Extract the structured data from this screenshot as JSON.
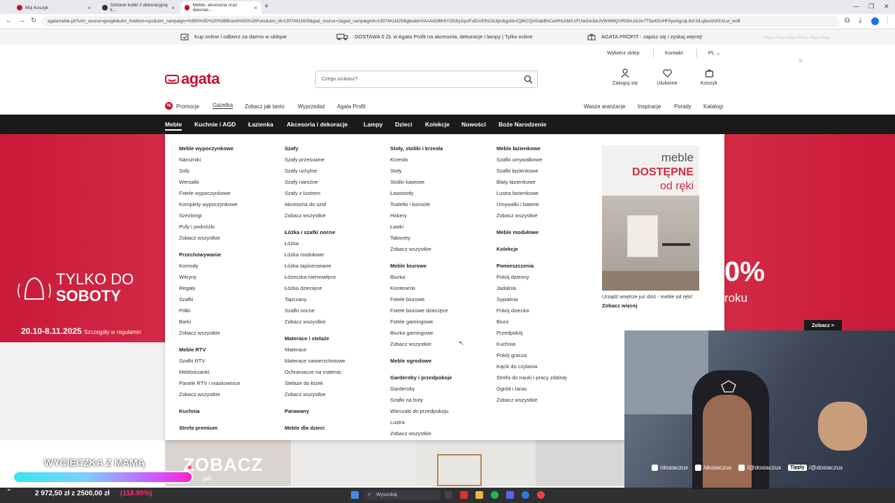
{
  "browser": {
    "tabs": [
      {
        "label": "Mój Koszyk"
      },
      {
        "label": "Szklane kubki z dekoracyjną k..."
      },
      {
        "label": "Meble, akcesoria oraz dekorac..."
      }
    ],
    "url": "agatameble.pl/?utm_source=google&utm_medium=cpc&utm_campaign=%5BS%5D%20%5BBrand%5D%20Pure&utm_id=13074411829&gad_source=1&gad_campaignid=13074411829&gbraid=0AAAADBK6YIZhKy1rpoFutDAEfhCbUIpc&gclid=Cj0KCQiA5abBhCaARIsAM3-zFUlaSre3drJVW4IMQVIR3ImJoUiv7TSp4OUHF8ywAgcqL9uf-5iLq8aAiAKEALw_wcB"
  },
  "infobar": {
    "item1": "Kup online i odbierz za darmo w sklepie",
    "item2": "DOSTAWA 0 ZŁ w Agata Profit na akcesoria, dekoracje i lampy | Tylko online",
    "item3": "AGATA PROFIT - zapisz się i zyskaj więcej!"
  },
  "utilbar": {
    "store": "Wybierz sklep",
    "contact": "Kontakt",
    "lang": "PL"
  },
  "header": {
    "logo": "agata",
    "search_placeholder": "Czego szukasz?",
    "login": "Zaloguj się",
    "favorites": "Ulubione",
    "cart": "Koszyk"
  },
  "subnav": {
    "left": [
      "Promocje",
      "Gazetka",
      "Zobacz jak tanio",
      "Wyprzedaż",
      "Agata Profit"
    ],
    "right": [
      "Wasze aranżacje",
      "Inspiracje",
      "Porady",
      "Katalogi"
    ]
  },
  "mainnav": [
    "Meble",
    "Kuchnie i AGD",
    "Łazienka",
    "Akcesoria i dekoracje",
    "Lampy",
    "Dzieci",
    "Kolekcje",
    "Nowości",
    "Boże Narodzenie"
  ],
  "mega": {
    "col1": [
      {
        "t": "Meble wypoczynkowe",
        "h": true
      },
      {
        "t": "Narożniki"
      },
      {
        "t": "Sofy"
      },
      {
        "t": "Wersalki"
      },
      {
        "t": "Fotele wypoczynkowe"
      },
      {
        "t": "Komplety wypoczynkowe"
      },
      {
        "t": "Szezlongi"
      },
      {
        "t": "Pufy i podnóżki"
      },
      {
        "t": "Zobacz wszystkie"
      },
      {
        "t": "Przechowywanie",
        "h": true
      },
      {
        "t": "Komody"
      },
      {
        "t": "Witryny"
      },
      {
        "t": "Regały"
      },
      {
        "t": "Szafki"
      },
      {
        "t": "Półki"
      },
      {
        "t": "Barki"
      },
      {
        "t": "Zobacz wszystkie"
      },
      {
        "t": "Meble RTV",
        "h": true
      },
      {
        "t": "Szafki RTV"
      },
      {
        "t": "Meblościanki"
      },
      {
        "t": "Panele RTV i maskownice"
      },
      {
        "t": "Zobacz wszystkie"
      },
      {
        "t": "Kuchnia",
        "h": true
      },
      {
        "t": "Strefa premium",
        "h": true
      }
    ],
    "col2": [
      {
        "t": "Szafy",
        "h": true
      },
      {
        "t": "Szafy przesuwne"
      },
      {
        "t": "Szafy uchylne"
      },
      {
        "t": "Szafy narożne"
      },
      {
        "t": "Szafy z lustrem"
      },
      {
        "t": "Akcesoria do szaf"
      },
      {
        "t": "Zobacz wszystkie"
      },
      {
        "t": "Łóżka i szafki nocne",
        "h": true
      },
      {
        "t": "Łóżka"
      },
      {
        "t": "Łóżka modułowe"
      },
      {
        "t": "Łóżka tapicerowane"
      },
      {
        "t": "Łóżeczka niemowlęce"
      },
      {
        "t": "Łóżka dziecięce"
      },
      {
        "t": "Tapczany"
      },
      {
        "t": "Szafki nocne"
      },
      {
        "t": "Zobacz wszystkie"
      },
      {
        "t": "Materace i stelaże",
        "h": true
      },
      {
        "t": "Materace"
      },
      {
        "t": "Materace nawierzchniowe"
      },
      {
        "t": "Ochraniacze na materac"
      },
      {
        "t": "Stelaże do łóżek"
      },
      {
        "t": "Zobacz wszystkie"
      },
      {
        "t": "Parawany",
        "h": true
      },
      {
        "t": "Meble dla dzieci",
        "h": true
      }
    ],
    "col3": [
      {
        "t": "Stoły, stoliki i krzesła",
        "h": true
      },
      {
        "t": "Krzesła"
      },
      {
        "t": "Stoły"
      },
      {
        "t": "Stoliki kawowe"
      },
      {
        "t": "Ławostoły"
      },
      {
        "t": "Toaletki i konsole"
      },
      {
        "t": "Hokery"
      },
      {
        "t": "Ławki"
      },
      {
        "t": "Taborety"
      },
      {
        "t": "Zobacz wszystkie"
      },
      {
        "t": "Meble biurowe",
        "h": true
      },
      {
        "t": "Biurka"
      },
      {
        "t": "Kontenerki"
      },
      {
        "t": "Fotele biurowe"
      },
      {
        "t": "Fotele biurowe dziecięce"
      },
      {
        "t": "Fotele gamingowe"
      },
      {
        "t": "Biurka gamingowe"
      },
      {
        "t": "Zobacz wszystkie"
      },
      {
        "t": "Meble ogrodowe",
        "h": true
      },
      {
        "t": "Garderoby i przedpokoje",
        "h": true
      },
      {
        "t": "Garderoby"
      },
      {
        "t": "Szafki na buty"
      },
      {
        "t": "Wieszaki do przedpokoju"
      },
      {
        "t": "Lustra"
      },
      {
        "t": "Zobacz wszystkie"
      }
    ],
    "col4": [
      {
        "t": "Meble łazienkowe",
        "h": true
      },
      {
        "t": "Szafki umywalkowe"
      },
      {
        "t": "Szafki łazienkowe"
      },
      {
        "t": "Blaty łazienkowe"
      },
      {
        "t": "Lustra łazienkowe"
      },
      {
        "t": "Umywalki i baterie"
      },
      {
        "t": "Zobacz wszystkie"
      },
      {
        "t": "Meble modułowe",
        "h": true
      },
      {
        "t": "Kolekcje",
        "h": true
      },
      {
        "t": "Pomieszczenia",
        "h": true
      },
      {
        "t": "Pokój dzienny"
      },
      {
        "t": "Jadalnia"
      },
      {
        "t": "Sypialnia"
      },
      {
        "t": "Pokój dziecka"
      },
      {
        "t": "Biuro"
      },
      {
        "t": "Przedpokój"
      },
      {
        "t": "Kuchnia"
      },
      {
        "t": "Pokój gracza"
      },
      {
        "t": "Kącik do czytania"
      },
      {
        "t": "Strefa do nauki i pracy zdalnej"
      },
      {
        "t": "Ogród i taras"
      },
      {
        "t": "Zobacz wszystkie"
      }
    ],
    "ad": {
      "line1": "meble",
      "line2": "DOSTĘPNE",
      "line3": "od ręki",
      "caption": "Urządź wnętrze już dziś - meble od ręki!",
      "more": "Zobacz więcej"
    }
  },
  "hero": {
    "left_line1": "TYLKO DO",
    "left_line2": "SOBOTY",
    "dates": "20.10-8.11.2025",
    "dates_note": "Szczegóły w regulamin",
    "right_percent": "0%",
    "right_word": "roku",
    "button": "Zobacz >"
  },
  "tiles": {
    "t1": "ZOBACZ",
    "t1_sub": "jak"
  },
  "overlay": {
    "title": "WYCIECZKA Z MAMĄ",
    "amount": "2 972,50 zł z 2500,00 zł",
    "percent": "(118.90%)",
    "progress": 1.0
  },
  "socials": [
    "/dosiaczux",
    "/dosiaczux",
    "/@dosiaczux",
    "/@dosiaczux"
  ],
  "tipply": "Tipply",
  "taskbar": {
    "search": "Wyszukaj"
  },
  "colors": {
    "brand": "#c8102e",
    "nav": "#1a1a1a",
    "hero": "#cc1f3c"
  }
}
